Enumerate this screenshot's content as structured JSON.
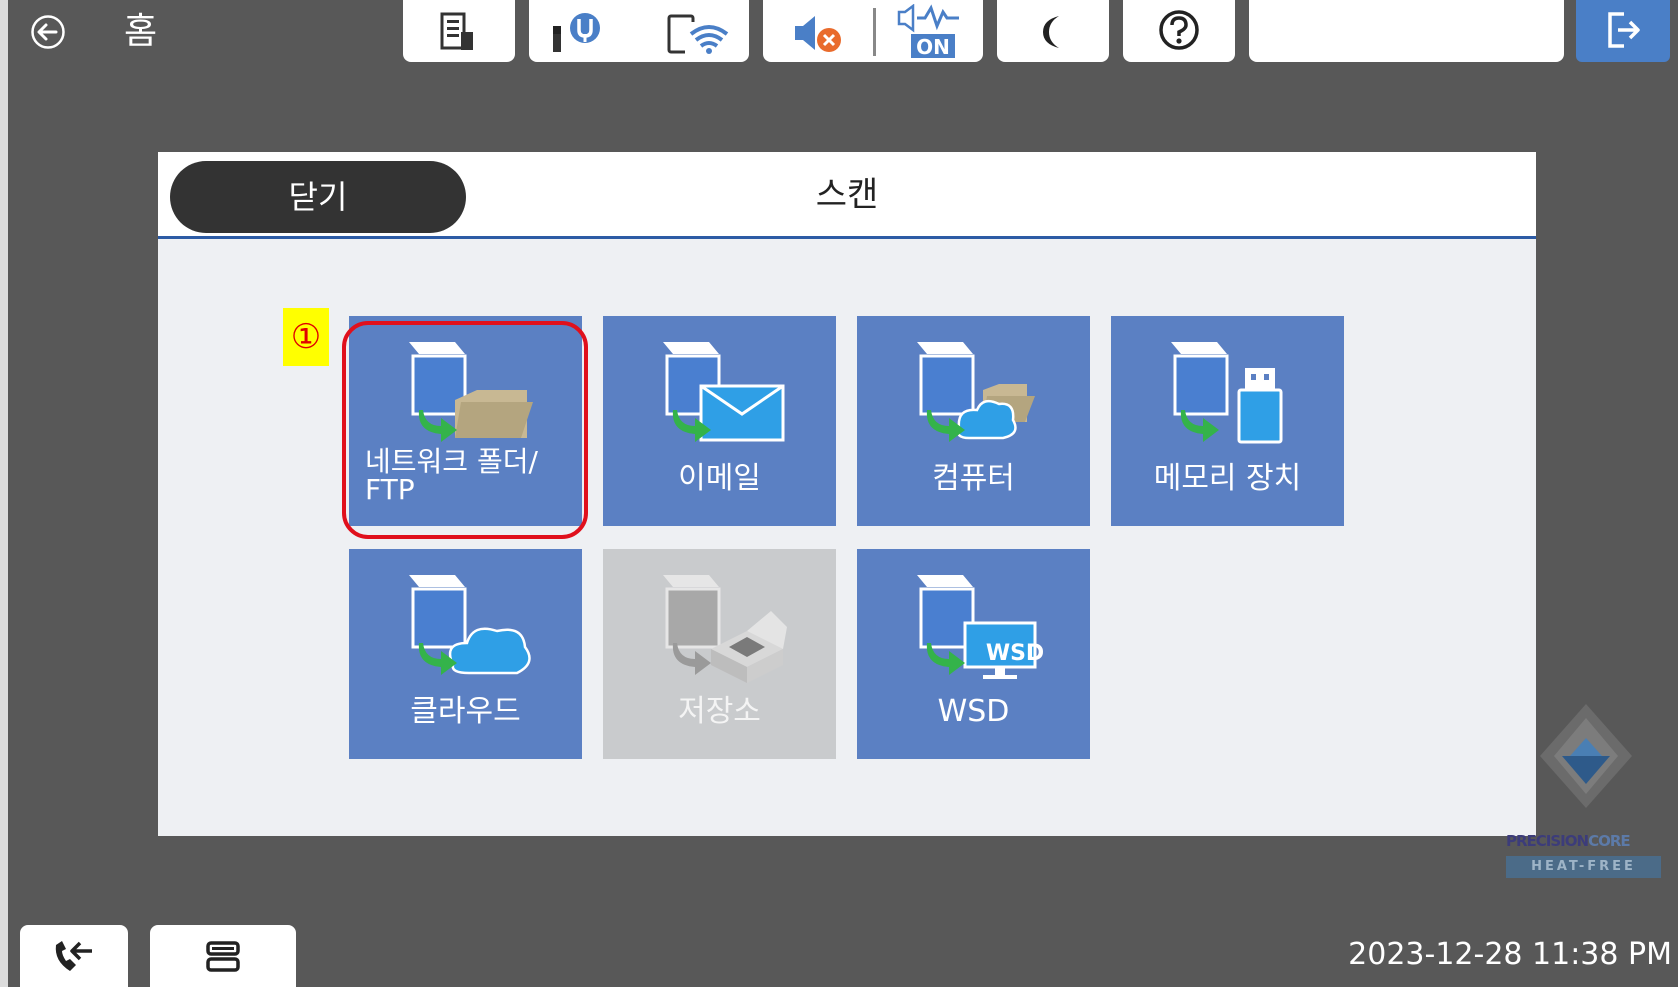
{
  "topbar": {
    "home_label": "홈",
    "status_icons": [
      "job-status-icon",
      "ink-icon",
      "wifi-icon",
      "mute-icon",
      "quiet-mode-icon",
      "sleep-icon",
      "help-icon"
    ],
    "status_badges": {
      "quiet_mode": "ON",
      "wsd": "WSD"
    }
  },
  "panel": {
    "close_label": "닫기",
    "title": "스캔",
    "tiles": [
      {
        "label": "네트워크 폴더/\nFTP",
        "line1": "네트워크 폴더/",
        "line2": "FTP",
        "icon": "network-folder-icon",
        "enabled": true
      },
      {
        "label": "이메일",
        "icon": "email-icon",
        "enabled": true
      },
      {
        "label": "컴퓨터",
        "icon": "computer-icon",
        "enabled": true
      },
      {
        "label": "메모리 장치",
        "icon": "memory-device-icon",
        "enabled": true
      },
      {
        "label": "클라우드",
        "icon": "cloud-icon",
        "enabled": true
      },
      {
        "label": "저장소",
        "icon": "storage-icon",
        "enabled": false
      },
      {
        "label": "WSD",
        "icon": "wsd-icon",
        "enabled": true
      }
    ],
    "annotation_marker": "①"
  },
  "brand": {
    "line1a": "PRECISION",
    "line1b": "CORE",
    "line2": "HEAT-FREE"
  },
  "bottom": {
    "datetime": "2023-12-28 11:38 PM"
  },
  "colors": {
    "tile": "#5b80c3",
    "tile_disabled": "#c9cbcd",
    "accent": "#2c5ba5",
    "highlight": "#e0101c"
  }
}
